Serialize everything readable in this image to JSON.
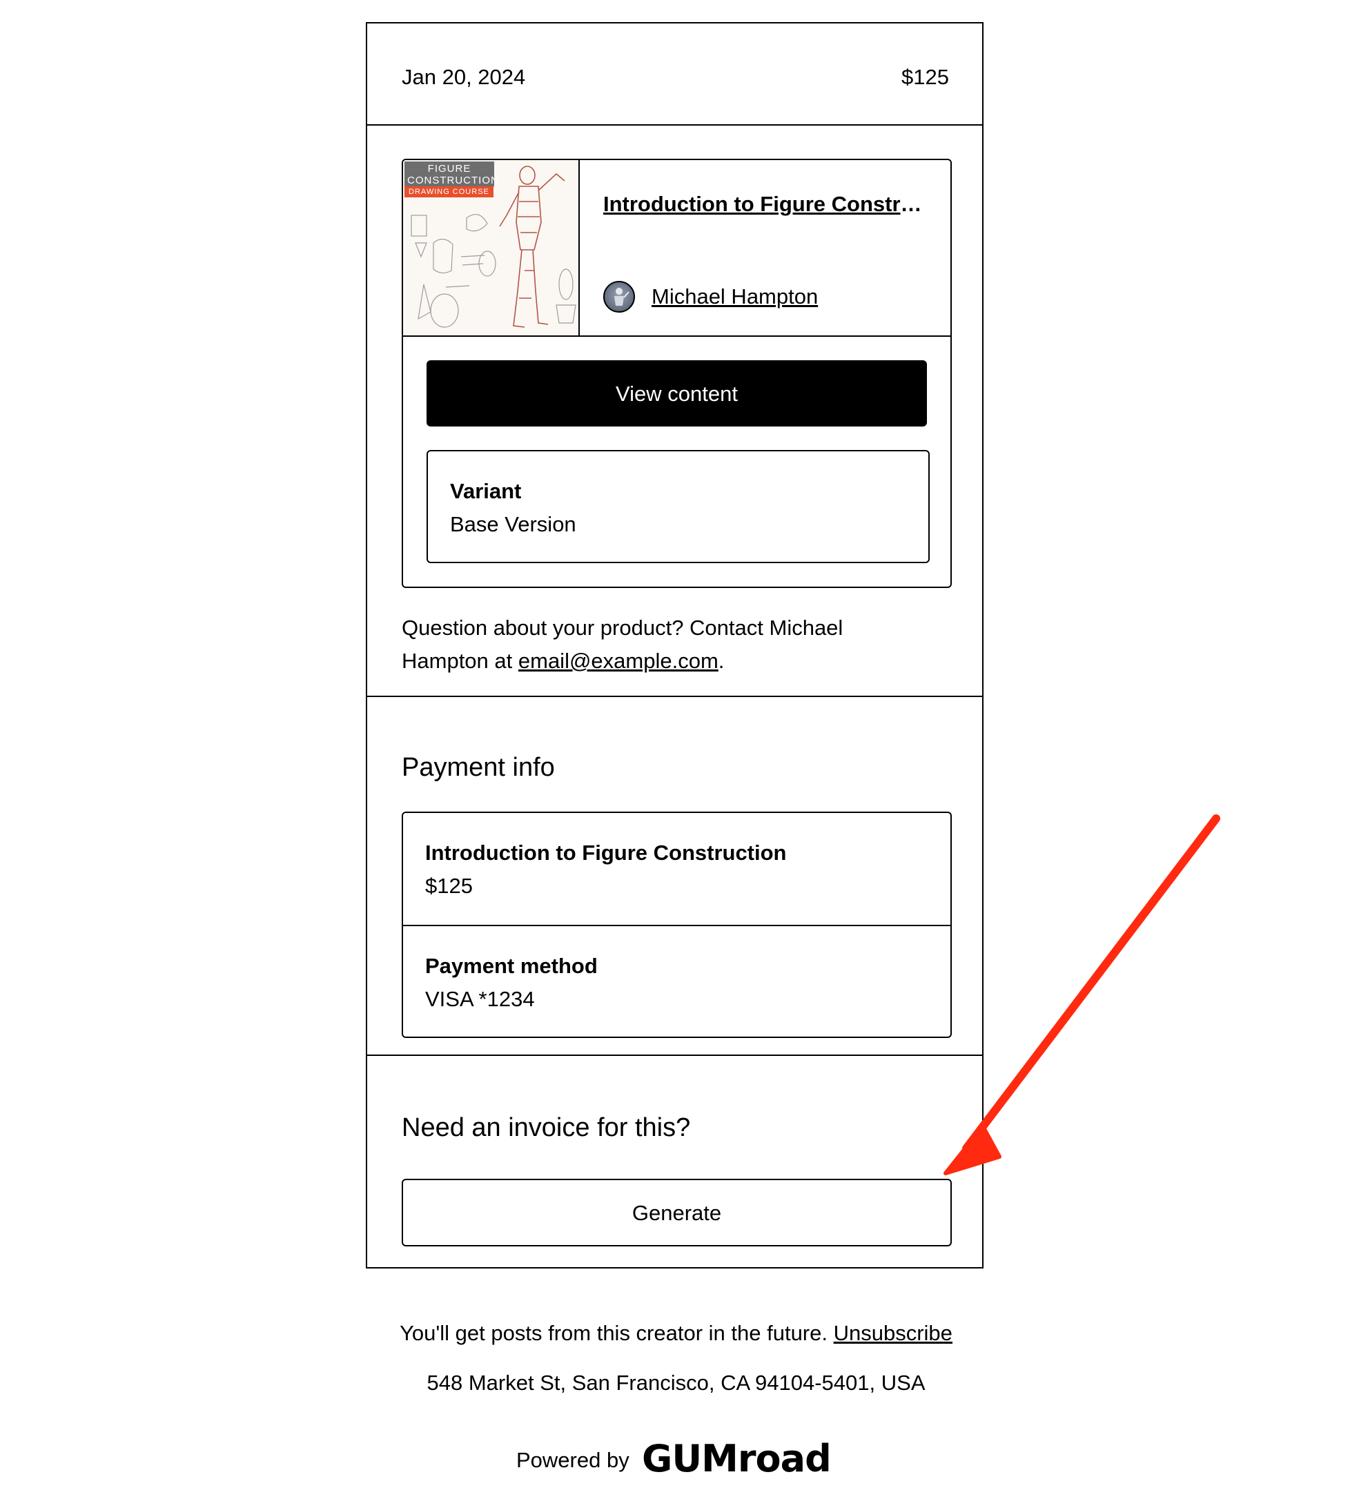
{
  "receipt": {
    "date": "Jan 20, 2024",
    "price": "$125"
  },
  "product": {
    "thumbnail": {
      "badge_line1": "FIGURE",
      "badge_line2": "CONSTRUCTION",
      "badge_sub": "DRAWING COURSE"
    },
    "title": "Introduction to Figure Construction",
    "creator_name": "Michael Hampton",
    "view_button_label": "View content",
    "variant_label": "Variant",
    "variant_value": "Base Version"
  },
  "contact": {
    "prefix": "Question about your product? Contact Michael Hampton at ",
    "email": "email@example.com",
    "suffix": "."
  },
  "payment": {
    "heading": "Payment info",
    "item_name": "Introduction to Figure Construction",
    "item_price": "$125",
    "method_label": "Payment method",
    "method_value": "VISA *1234"
  },
  "invoice": {
    "heading": "Need an invoice for this?",
    "button_label": "Generate"
  },
  "footer": {
    "subscribe_text": "You'll get posts from this creator in the future. ",
    "unsubscribe_label": "Unsubscribe",
    "address": "548 Market St, San Francisco, CA 94104-5401, USA",
    "powered_by": "Powered by",
    "brand": "GUMroad"
  },
  "colors": {
    "annotation_arrow": "#ff2a10",
    "thumb_badge": "#6e6e6e",
    "thumb_badge_sub": "#e8502c"
  },
  "icons": {
    "annotation": "red-arrow-icon",
    "avatar": "creator-avatar"
  }
}
